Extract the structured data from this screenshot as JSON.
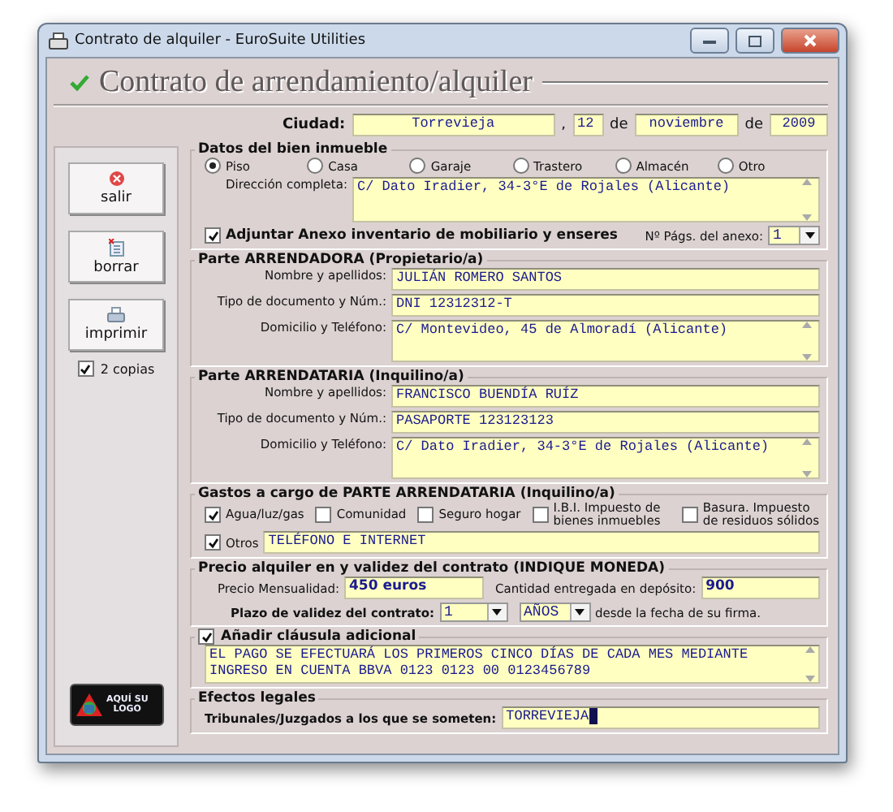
{
  "window": {
    "title": "Contrato de alquiler - EuroSuite Utilities"
  },
  "heading": "Contrato de arrendamiento/alquiler",
  "sidebar": {
    "buttons": [
      {
        "label": "salir",
        "kind": "exit"
      },
      {
        "label": "borrar",
        "kind": "clear"
      },
      {
        "label": "imprimir",
        "kind": "print"
      }
    ],
    "copies": {
      "label": "2 copias",
      "checked": true
    },
    "logo": {
      "line_1": "AQUÍ SU",
      "line_2": "LOGO"
    }
  },
  "date_line": {
    "city_label": "Ciudad:",
    "city": "Torrevieja",
    "comma": ",",
    "day": "12",
    "de_1": "de",
    "month": "noviembre",
    "de_2": "de",
    "year": "2009"
  },
  "property": {
    "title": "Datos del bien inmueble",
    "types": [
      {
        "label": "Piso",
        "selected": true
      },
      {
        "label": "Casa",
        "selected": false
      },
      {
        "label": "Garaje",
        "selected": false
      },
      {
        "label": "Trastero",
        "selected": false
      },
      {
        "label": "Almacén",
        "selected": false
      },
      {
        "label": "Otro",
        "selected": false
      }
    ],
    "address_label": "Dirección completa:",
    "address": "C/ Dato Iradier, 34-3°E de Rojales (Alicante)",
    "annex": {
      "label": "Adjuntar Anexo inventario de mobiliario y enseres",
      "checked": true
    },
    "pages_label": "Nº Págs. del anexo:",
    "pages": "1"
  },
  "parties": [
    {
      "title": "Parte ARRENDADORA (Propietario/a)",
      "fields": [
        {
          "label": "Nombre y apellidos:",
          "value": "JULIÁN ROMERO SANTOS",
          "kind": "line"
        },
        {
          "label": "Tipo de documento y Núm.:",
          "value": "DNI 12312312-T",
          "kind": "line"
        },
        {
          "label": "Domicilio y Teléfono:",
          "value": "C/ Montevideo, 45 de Almoradí (Alicante)",
          "kind": "area"
        }
      ]
    },
    {
      "title": "Parte ARRENDATARIA (Inquilino/a)",
      "fields": [
        {
          "label": "Nombre y apellidos:",
          "value": "FRANCISCO BUENDÍA RUÍZ",
          "kind": "line"
        },
        {
          "label": "Tipo de documento y Núm.:",
          "value": "PASAPORTE 123123123",
          "kind": "line"
        },
        {
          "label": "Domicilio y Teléfono:",
          "value": "C/ Dato Iradier, 34-3°E de Rojales (Alicante)",
          "kind": "area"
        }
      ]
    }
  ],
  "expenses": {
    "title": "Gastos a cargo de PARTE ARRENDATARIA (Inquilino/a)",
    "items": [
      {
        "label": "Agua/luz/gas",
        "checked": true
      },
      {
        "label": "Comunidad",
        "checked": false
      },
      {
        "label": "Seguro hogar",
        "checked": false
      },
      {
        "label": "I.B.I. Impuesto de bienes inmuebles",
        "checked": false
      },
      {
        "label": "Basura. Impuesto de residuos sólidos",
        "checked": false
      }
    ],
    "other": {
      "label": "Otros",
      "checked": true,
      "value": "TELÉFONO E INTERNET"
    }
  },
  "price": {
    "title": "Precio alquiler en y validez del contrato (INDIQUE MONEDA)",
    "monthly_label": "Precio Mensualidad:",
    "monthly": "450 euros",
    "deposit_label": "Cantidad entregada en depósito:",
    "deposit": "900",
    "term_label": "Plazo de validez del contrato:",
    "term": "1",
    "unit": "AÑOS",
    "term_suffix": "desde la fecha de su firma."
  },
  "clause": {
    "label": "Añadir cláusula adicional",
    "checked": true,
    "text": "EL PAGO SE EFECTUARÁ LOS PRIMEROS CINCO DÍAS DE CADA MES MEDIANTE INGRESO EN CUENTA BBVA 0123 0123 00 0123456789"
  },
  "legal": {
    "title": "Efectos legales",
    "label": "Tribunales/Juzgados a los que se someten:",
    "value": "TORREVIEJA"
  }
}
